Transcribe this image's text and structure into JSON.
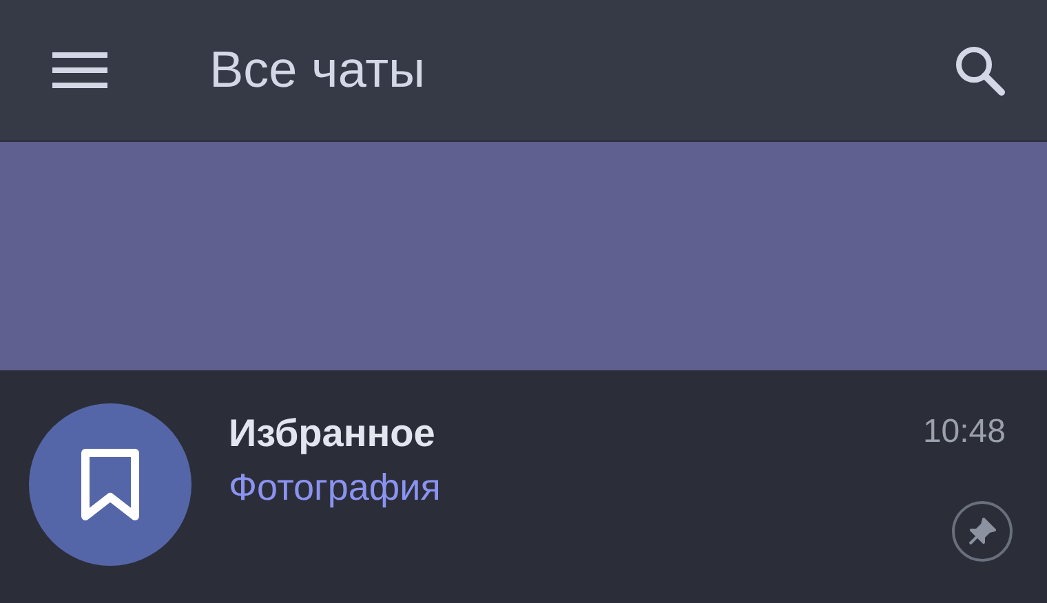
{
  "header": {
    "title": "Все чаты"
  },
  "chats": [
    {
      "name": "Избранное",
      "preview": "Фотография",
      "time": "10:48",
      "pinned": true,
      "kind": "saved"
    }
  ]
}
